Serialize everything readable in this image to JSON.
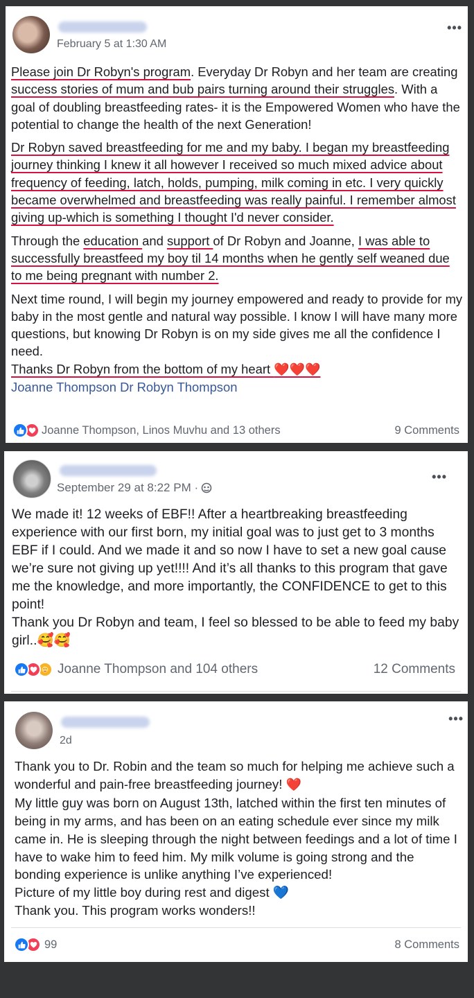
{
  "post1": {
    "time": "February 5 at 1:30 AM",
    "more": "•••",
    "paragraphs": {
      "p1a": "Please join Dr Robyn's program",
      "p1b": ". Everyday Dr Robyn and her team are creating ",
      "p1c": "success stories of mum and bub pairs turning around their struggles",
      "p1d": ". With a goal of doubling breastfeeding rates- it is the Empowered Women who have the potential to change the health of the next Generation!",
      "p2a": "Dr Robyn saved breastfeeding for me and my baby.",
      "p2b": " I began my breastfeeding journey thinking I knew it all however I received so much mixed advice about frequency of feeding, latch, holds, pumping, milk coming in etc. I very quickly became overwhelmed and breastfeeding was really painful. I remember almost giving up-which is something I thought I'd never consider.",
      "p3a": "Through the ",
      "p3b": "education ",
      "p3c": "and ",
      "p3d": "support ",
      "p3e": "of Dr Robyn and Joanne, ",
      "p3f": "I was able to successfully breastfeed my boy til 14 months when he gently self weaned due to me being pregnant with number 2.",
      "p4": "Next time round, I will begin my journey empowered and ready to provide for my baby in the most gentle and natural way possible. I know I will have many more questions, but knowing Dr Robyn is on my side gives me all the confidence I need.",
      "p5": "Thanks Dr Robyn from the bottom of my heart ",
      "hearts": "❤️❤️❤️",
      "tags": "Joanne Thompson Dr Robyn Thompson"
    },
    "reactions_text": "Joanne Thompson, Linos Muvhu and 13 others",
    "comments": "9 Comments"
  },
  "post2": {
    "time": "September 29 at 8:22 PM · ",
    "more": "•••",
    "text1": "We made it! 12 weeks of EBF!! After a heartbreaking breastfeeding experience with our first born, my initial goal was to just get to 3 months EBF if I could. And we made it and so now I have to set a new goal cause we’re sure not giving up yet!!!! And it’s all thanks to this program that gave me the knowledge, and more importantly, the CONFIDENCE to get to this point!",
    "text2": "Thank you Dr Robyn and team, I feel so blessed to be able to feed my baby girl..",
    "emoji": "🥰🥰",
    "reactions_text": "Joanne Thompson and 104 others",
    "comments": "12 Comments"
  },
  "post3": {
    "time": "2d",
    "more": "•••",
    "line1": "Thank you to Dr. Robin and the team so much for helping me achieve such a wonderful and pain-free breastfeeding journey! ",
    "heart1": "❤️",
    "line2": "My little guy was born on August 13th, latched within the first ten minutes of being in my arms, and has been on an eating schedule ever since my milk came in. He is sleeping through the night between feedings and a lot of time I have to wake him to feed him. My milk volume is going strong and the bonding experience is unlike anything I’ve experienced!",
    "line3": "Picture of my little boy during rest and digest ",
    "heart2": "💙",
    "line4": "Thank you. This program works wonders!!",
    "reactions_count": "99",
    "comments": "8 Comments"
  },
  "colors": {
    "underline": "#d4123f",
    "like": "#1877f2",
    "love": "#f33e58",
    "tag": "#385898"
  }
}
